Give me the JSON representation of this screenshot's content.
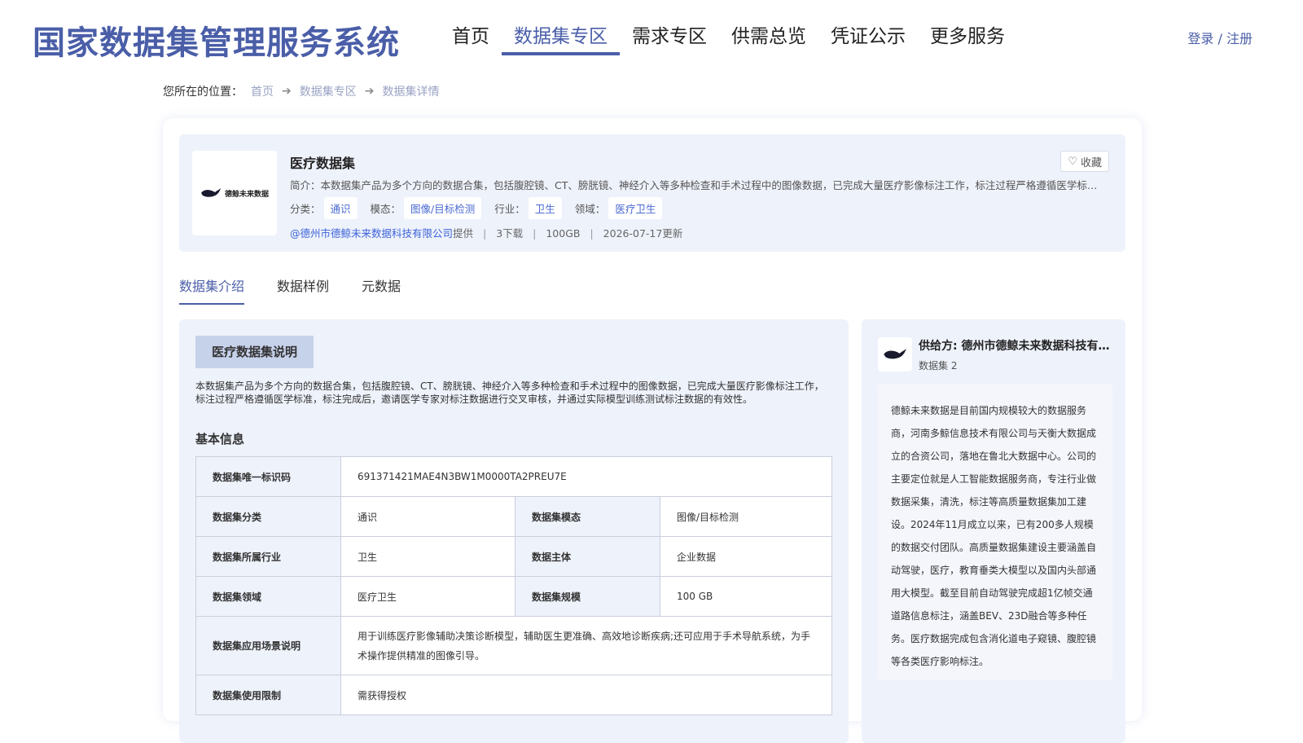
{
  "header": {
    "site_title": "国家数据集管理服务系统",
    "nav": [
      "首页",
      "数据集专区",
      "需求专区",
      "供需总览",
      "凭证公示",
      "更多服务"
    ],
    "active_nav": 1,
    "login_label": "登录 / 注册"
  },
  "breadcrumb": {
    "prefix": "您所在的位置：",
    "items": [
      "首页",
      "数据集专区",
      "数据集详情"
    ]
  },
  "dataset": {
    "logo_text": "德鲸未来数据",
    "name": "医疗数据集",
    "intro": "简介：本数据集产品为多个方向的数据合集，包括腹腔镜、CT、膀胱镜、神经介入等多种检查和手术过程中的图像数据，已完成大量医疗影像标注工作，标注过程严格遵循医学标准，标注完成后，邀请医学专家对标注数据进行交叉审核，并通过实际模型训练测试标注数据的有效性。",
    "fav_label": "收藏",
    "tags": [
      {
        "label": "分类：",
        "value": "通识"
      },
      {
        "label": "模态：",
        "value": "图像/目标检测"
      },
      {
        "label": "行业：",
        "value": "卫生"
      },
      {
        "label": "领域：",
        "value": "医疗卫生"
      }
    ],
    "provider": "@德州市德鲸未来数据科技有限公司",
    "provider_suffix": "提供",
    "downloads": "3下载",
    "size": "100GB",
    "updated": "2026-07-17更新"
  },
  "tabs": [
    "数据集介绍",
    "数据样例",
    "元数据"
  ],
  "main": {
    "section_title": "医疗数据集说明",
    "description": "本数据集产品为多个方向的数据合集，包括腹腔镜、CT、膀胱镜、神经介入等多种检查和手术过程中的图像数据，已完成大量医疗影像标注工作，标注过程严格遵循医学标准，标注完成后，邀请医学专家对标注数据进行交叉审核，并通过实际模型训练测试标注数据的有效性。",
    "basic_title": "基本信息",
    "table": {
      "id_key": "数据集唯一标识码",
      "id_value": "691371421MAE4N3BW1M0000TA2PREU7E",
      "category_key": "数据集分类",
      "category_value": "通识",
      "modality_key": "数据集模态",
      "modality_value": "图像/目标检测",
      "industry_key": "数据集所属行业",
      "industry_value": "卫生",
      "subject_key": "数据主体",
      "subject_value": "企业数据",
      "domain_key": "数据集领域",
      "domain_value": "医疗卫生",
      "scale_key": "数据集规模",
      "scale_value": "100 GB",
      "scenario_key": "数据集应用场景说明",
      "scenario_value": "用于训练医疗影像辅助决策诊断模型，辅助医生更准确、高效地诊断疾病;还可应用于手术导航系统，为手术操作提供精准的图像引导。",
      "limit_key": "数据集使用限制",
      "limit_value": "需获得授权"
    }
  },
  "side": {
    "logo_text": "德鲸未来数据",
    "provider_name": "供给方: 德州市德鲸未来数据科技有限公司",
    "dataset_count": "数据集 2",
    "description": "德鲸未来数据是目前国内规模较大的数据服务商，河南多鲸信息技术有限公司与天衡大数据成立的合资公司，落地在鲁北大数据中心。公司的主要定位就是人工智能数据服务商，专注行业做数据采集，清洗，标注等高质量数据集加工建设。2024年11月成立以来，已有200多人规模的数据交付团队。高质量数据集建设主要涵盖自动驾驶，医疗，教育垂类大模型以及国内头部通用大模型。截至目前自动驾驶完成超1亿帧交通道路信息标注，涵盖BEV、23D融合等多种任务。医疗数据完成包含消化道电子窥镜、腹腔镜等各类医疗影响标注。"
  }
}
